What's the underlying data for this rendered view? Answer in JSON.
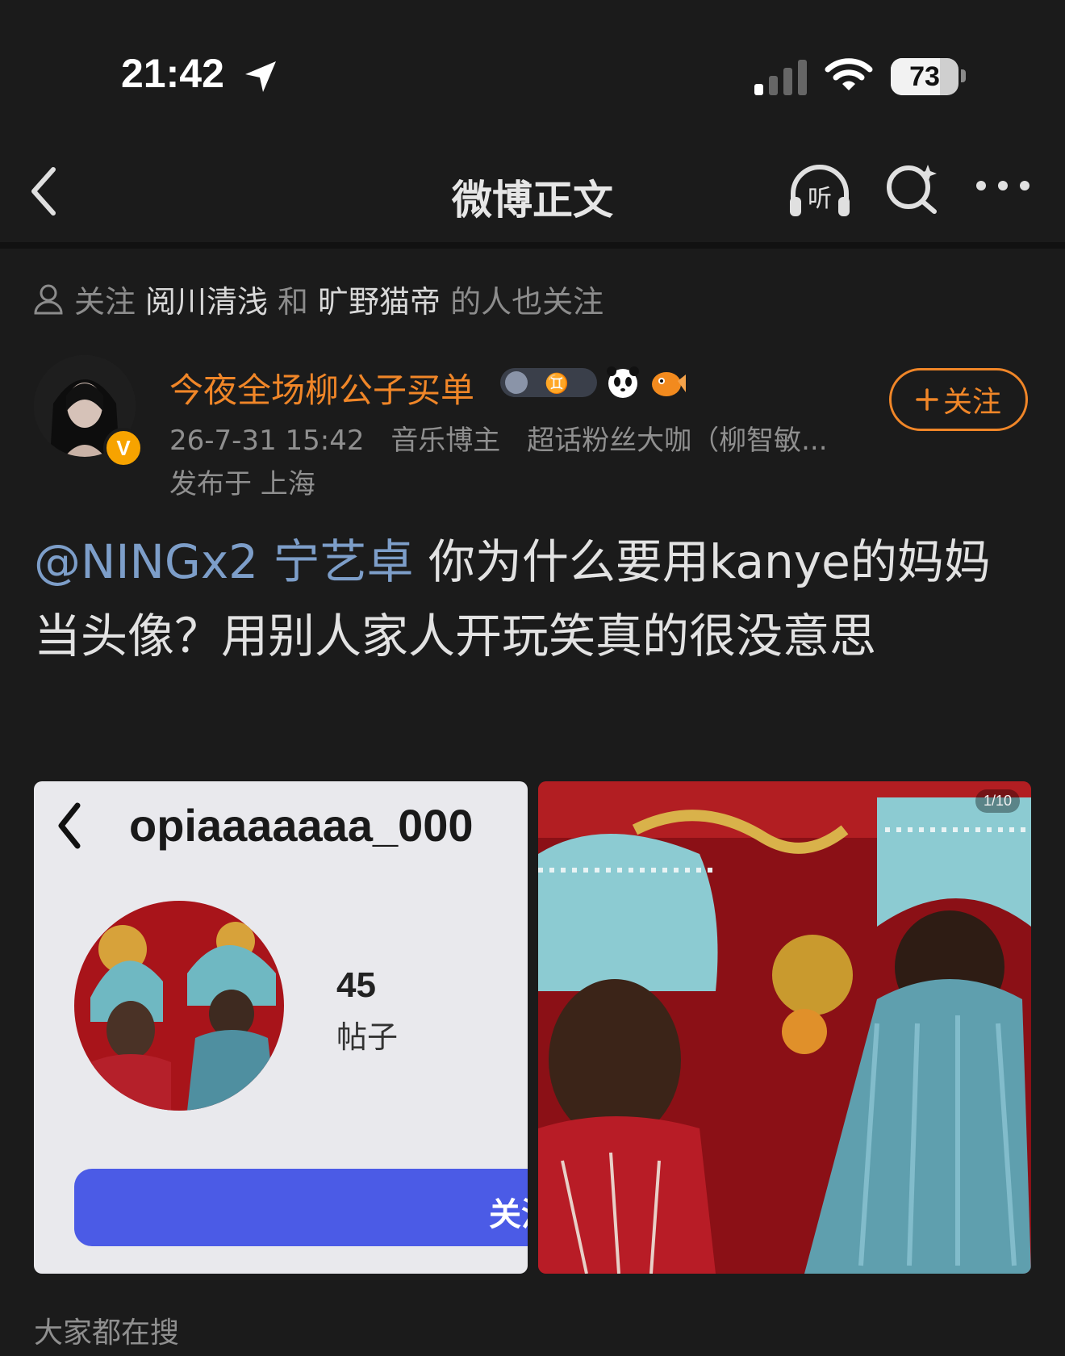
{
  "status_bar": {
    "time": "21:42",
    "battery": "73",
    "battery_level": 0.73
  },
  "nav": {
    "title": "微博正文",
    "listen_label": "听"
  },
  "recommend": {
    "prefix": "关注",
    "user1": "阅川清浅",
    "conj": "和",
    "user2": "旷野猫帝",
    "suffix": "的人也关注"
  },
  "post": {
    "author": "今夜全场柳公子买单",
    "avatar_badge": "V",
    "date": "26-7-31 15:42",
    "tag1": "音乐博主",
    "tag2": "超话粉丝大咖（柳智敏...",
    "location": "发布于 上海",
    "follow_label": "关注",
    "mention": "@NINGx2 宁艺卓",
    "text": " 你为什么要用kanye的妈妈当头像？用别人家人开玩笑真的很没意思"
  },
  "images": {
    "left": {
      "username": "opiaaaaaaa_000",
      "count": "45",
      "count_label": "帖子",
      "follow_label": "关注"
    },
    "right": {
      "counter": "1/10"
    }
  },
  "trending": {
    "label": "大家都在搜"
  },
  "colors": {
    "background": "#1b1b1b",
    "accent_orange": "#f08628",
    "mention_blue": "#7d9ec9",
    "ig_button": "#4b5be6"
  }
}
